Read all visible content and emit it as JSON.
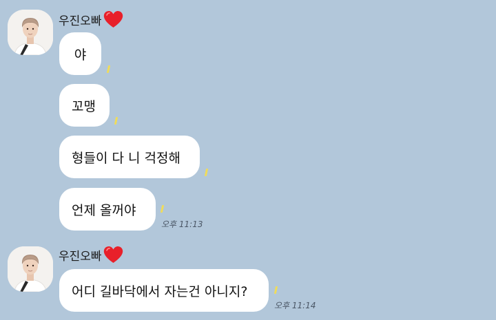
{
  "chat": {
    "groups": [
      {
        "sender": "우진오빠",
        "messages": [
          {
            "text": "야"
          },
          {
            "text": "꼬맹"
          },
          {
            "text": "형들이 다 니 걱정해"
          },
          {
            "text": "언제 올꺼야",
            "time": "오후 11:13"
          }
        ]
      },
      {
        "sender": "우진오빠",
        "messages": [
          {
            "text": "어디 길바닥에서 자는건 아니지?",
            "time": "오후 11:14"
          }
        ]
      }
    ]
  },
  "colors": {
    "background": "#b2c7da",
    "bubble": "#ffffff",
    "heart": "#e8202a",
    "read_mark": "#f0dc5a"
  },
  "icons": {
    "heart": "heart-icon",
    "avatar": "profile-photo"
  }
}
